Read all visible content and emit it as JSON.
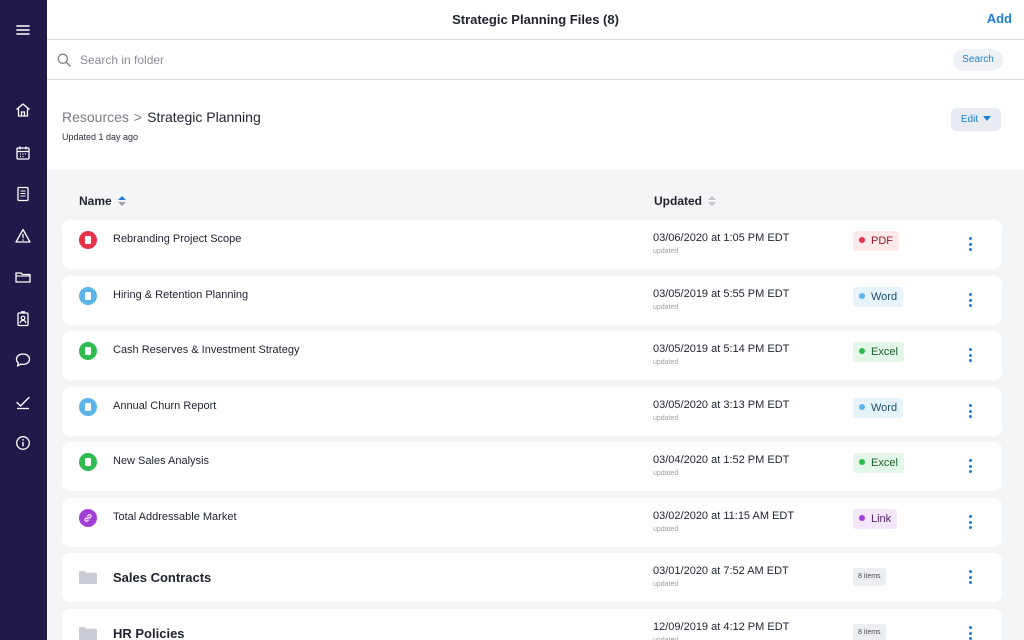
{
  "header": {
    "title": "Strategic Planning Files (8)",
    "add_label": "Add"
  },
  "search": {
    "placeholder": "Search in folder",
    "button_label": "Search"
  },
  "breadcrumb": {
    "root": "Resources",
    "separator": ">",
    "current": "Strategic Planning"
  },
  "folder_updated": "Updated 1 day ago",
  "edit_label": "Edit",
  "columns": {
    "name": "Name",
    "updated": "Updated"
  },
  "sidebar": {
    "icons": [
      "menu-icon",
      "home-icon",
      "calendar-icon",
      "document-icon",
      "warning-icon",
      "folder-icon",
      "contacts-icon",
      "chat-icon",
      "checkmark-icon",
      "info-icon"
    ]
  },
  "rows": [
    {
      "kind": "file",
      "name": "Rebranding Project Scope",
      "date": "03/06/2020 at 1:05 PM EDT",
      "date_sub": "updated",
      "type": "PDF",
      "icon": "pdf-file-icon",
      "icon_color": "#e8344a",
      "badge_bg": "#fde8ea",
      "badge_text": "#9a1b2a",
      "dot": "#e8344a"
    },
    {
      "kind": "file",
      "name": "Hiring & Retention Planning",
      "date": "03/05/2019 at 5:55 PM EDT",
      "date_sub": "updated",
      "type": "Word",
      "icon": "word-file-icon",
      "icon_color": "#5bb4ea",
      "badge_bg": "#e6f3fb",
      "badge_text": "#1d4d6e",
      "dot": "#5bb4ea"
    },
    {
      "kind": "file",
      "name": "Cash Reserves & Investment Strategy",
      "date": "03/05/2019 at 5:14 PM EDT",
      "date_sub": "updated",
      "type": "Excel",
      "icon": "excel-file-icon",
      "icon_color": "#2fbb4f",
      "badge_bg": "#e4f6e8",
      "badge_text": "#1a5c2a",
      "dot": "#2fbb4f"
    },
    {
      "kind": "file",
      "name": "Annual Churn Report",
      "date": "03/05/2020 at 3:13 PM EDT",
      "date_sub": "updated",
      "type": "Word",
      "icon": "word-file-icon",
      "icon_color": "#5bb4ea",
      "badge_bg": "#e6f3fb",
      "badge_text": "#1d4d6e",
      "dot": "#5bb4ea"
    },
    {
      "kind": "file",
      "name": "New Sales Analysis",
      "date": "03/04/2020 at 1:52 PM EDT",
      "date_sub": "updated",
      "type": "Excel",
      "icon": "excel-file-icon",
      "icon_color": "#2fbb4f",
      "badge_bg": "#e4f6e8",
      "badge_text": "#1a5c2a",
      "dot": "#2fbb4f"
    },
    {
      "kind": "link",
      "name": "Total Addressable Market",
      "date": "03/02/2020 at 11:15 AM EDT",
      "date_sub": "updated",
      "type": "Link",
      "icon": "link-icon",
      "icon_color": "#a13fd6",
      "badge_bg": "#f4e7fb",
      "badge_text": "#4d1f6b",
      "dot": "#a13fd6"
    },
    {
      "kind": "folder",
      "name": "Sales Contracts",
      "date": "03/01/2020 at 7:52 AM EDT",
      "date_sub": "updated",
      "type": "8 items",
      "icon": "folder-icon"
    },
    {
      "kind": "folder",
      "name": "HR Policies",
      "date": "12/09/2019 at 4:12 PM EDT",
      "date_sub": "updated",
      "type": "8 items",
      "icon": "folder-icon"
    }
  ]
}
